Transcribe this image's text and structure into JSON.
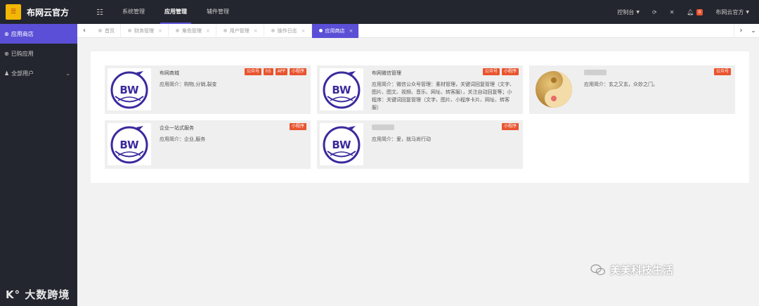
{
  "app": {
    "title": "布网云官方"
  },
  "topnav": {
    "toggle_icon": "menu-icon",
    "items": [
      {
        "label": "系统管理",
        "active": false
      },
      {
        "label": "应用管理",
        "active": true
      },
      {
        "label": "辅件管理",
        "active": false
      }
    ],
    "right": {
      "console": "控制台",
      "notify_count": "0",
      "user": "布网云官方"
    }
  },
  "sidebar": {
    "items": [
      {
        "label": "应用商店",
        "icon": "store-icon",
        "active": true
      },
      {
        "label": "已购应用",
        "icon": "purchased-icon",
        "active": false
      },
      {
        "label": "全部用户",
        "icon": "user-icon",
        "active": false
      }
    ]
  },
  "tabs": [
    {
      "label": "首页",
      "active": false
    },
    {
      "label": "财务管理",
      "active": false
    },
    {
      "label": "角色管理",
      "active": false
    },
    {
      "label": "用户管理",
      "active": false
    },
    {
      "label": "操作日志",
      "active": false
    },
    {
      "label": "应用商店",
      "active": true
    }
  ],
  "apps": [
    {
      "title": "布网商城",
      "desc": "应用简介：购物,分销,裂变",
      "tags": [
        "公众号",
        "h5",
        "APP",
        "小程序"
      ],
      "logo": "bw-logo"
    },
    {
      "title": "布网微信管理",
      "desc": "应用简介：微信公众号管理：素材管理，关键词回复管理（文字、图片、图文、视频、音乐、网址、转客服），关注自动回复等；小程序：关键词回复管理（文字、图片、小程序卡片、网址、转客服）",
      "tags": [
        "公众号",
        "小程序"
      ],
      "logo": "bw-logo"
    },
    {
      "title": "",
      "desc": "应用简介：玄之又玄，众妙之门。",
      "tags": [
        "公众号"
      ],
      "logo": "yinyang-logo"
    },
    {
      "title": "企业一站式服务",
      "desc": "应用简介：企业,服务",
      "tags": [
        "小程序"
      ],
      "logo": "bw-logo"
    },
    {
      "title": "",
      "desc": "应用简介：爱，就马尚行动",
      "tags": [
        "小程序"
      ],
      "logo": "bw-logo"
    }
  ],
  "watermarks": {
    "left": "大数跨境",
    "right": "美美科技生活"
  },
  "colors": {
    "accent": "#5a4fd6",
    "tag": "#e8542f",
    "dark": "#23262e"
  }
}
